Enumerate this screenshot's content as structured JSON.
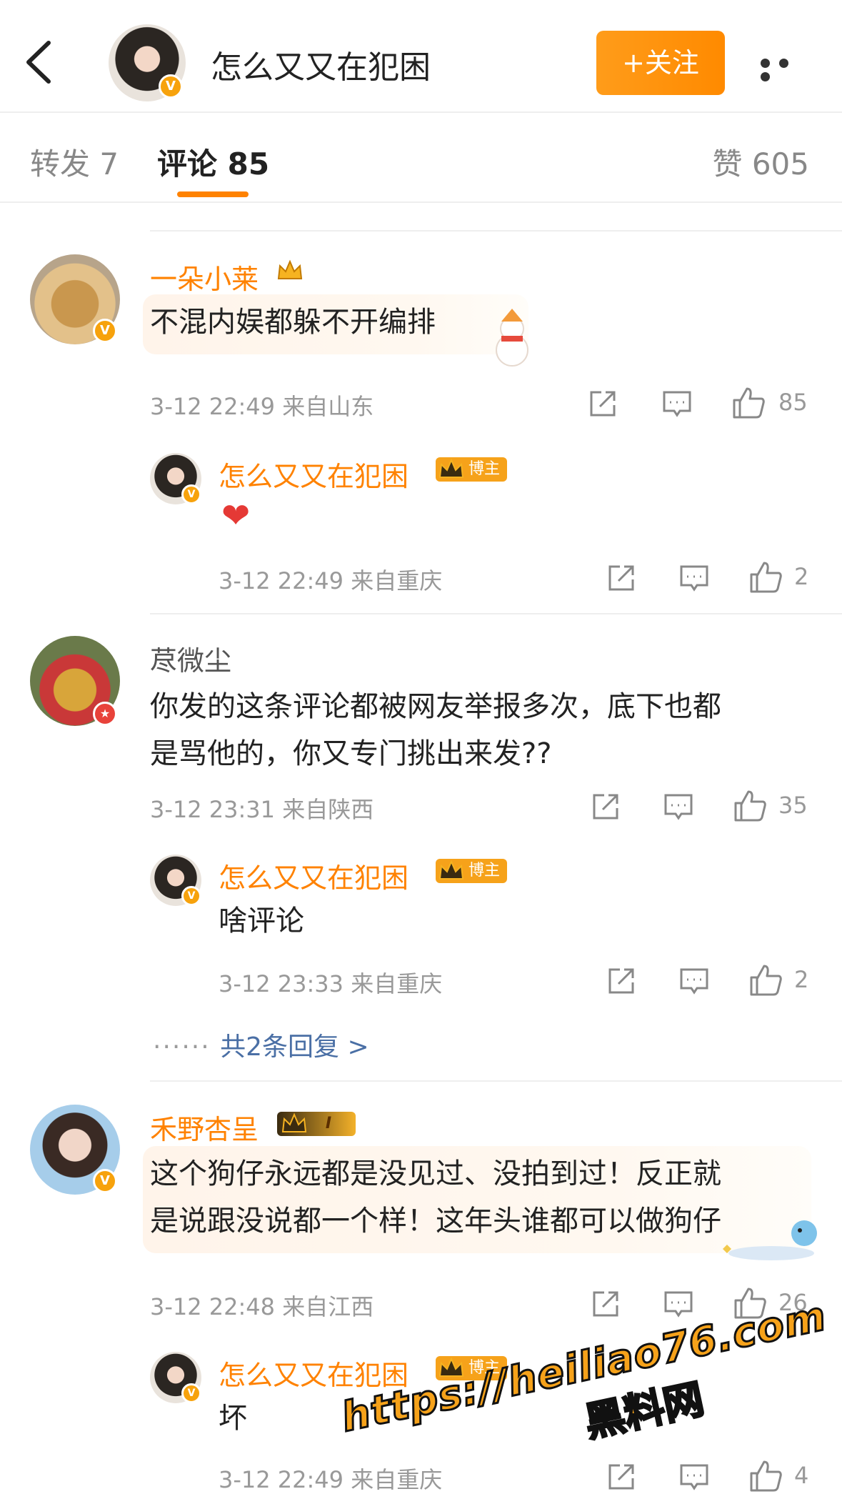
{
  "header": {
    "title": "怎么又又在犯困",
    "follow_label": "+关注",
    "badge": "V"
  },
  "tabs": {
    "repost": "转发 7",
    "comment": "评论 85",
    "likes": "赞 605"
  },
  "comments": [
    {
      "user": "一朵小莱",
      "text": "不混内娱都躲不开编排",
      "time": "3-12 22:49 来自山东",
      "likes": "85",
      "reply": {
        "user": "怎么又又在犯困",
        "tag": "博主",
        "text": "❤",
        "time": "3-12 22:49 来自重庆",
        "likes": "2"
      }
    },
    {
      "user": "荩微尘",
      "text_line1": "你发的这条评论都被网友举报多次，底下也都",
      "text_line2": "是骂他的，你又专门挑出来发??",
      "time": "3-12 23:31 来自陕西",
      "likes": "35",
      "reply": {
        "user": "怎么又又在犯困",
        "tag": "博主",
        "text": "啥评论",
        "time": "3-12 23:33 来自重庆",
        "likes": "2"
      },
      "more_replies": "共2条回复 >"
    },
    {
      "user": "禾野杏呈",
      "level": "I",
      "text_line1": "这个狗仔永远都是没见过、没拍到过！反正就",
      "text_line2": "是说跟没说都一个样！这年头谁都可以做狗仔",
      "time": "3-12 22:48 来自江西",
      "likes": "26",
      "reply": {
        "user": "怎么又又在犯困",
        "tag": "博主",
        "text": "坏",
        "time": "3-12 22:49 来自重庆",
        "likes": "4"
      }
    }
  ],
  "watermark": {
    "url": "https://heiliao76.com",
    "name": "黑料网"
  },
  "colors": {
    "accent": "#ff8200",
    "username": "#ff8200",
    "meta": "#999999"
  }
}
